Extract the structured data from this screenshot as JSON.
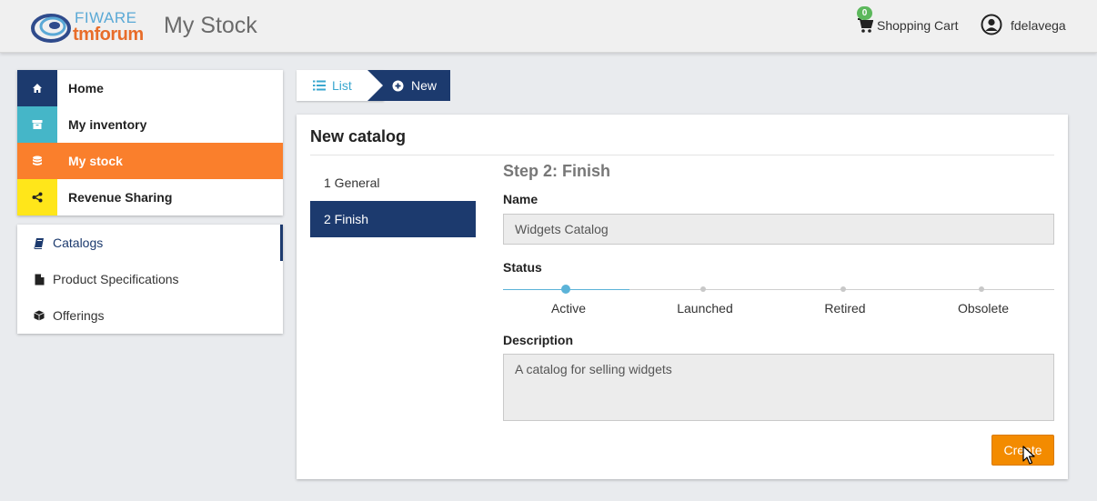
{
  "header": {
    "logo_text_top": "FIWARE",
    "logo_text_bottom": "tmforum",
    "title": "My Stock",
    "cart_count": "0",
    "cart_label": "Shopping Cart",
    "user_name": "fdelavega"
  },
  "sidebar": {
    "items": [
      {
        "label": "Home",
        "icon": "home-icon",
        "color": "#1c3a6e"
      },
      {
        "label": "My inventory",
        "icon": "archive-icon",
        "color": "#45b6c8"
      },
      {
        "label": "My stock",
        "icon": "database-icon",
        "color": "#fa7f2c"
      },
      {
        "label": "Revenue Sharing",
        "icon": "share-icon",
        "color": "#ffe61a"
      }
    ],
    "sub_items": [
      {
        "label": "Catalogs",
        "icon": "book-icon"
      },
      {
        "label": "Product Specifications",
        "icon": "file-icon"
      },
      {
        "label": "Offerings",
        "icon": "cube-icon"
      }
    ]
  },
  "breadcrumb": {
    "list_label": "List",
    "new_label": "New"
  },
  "panel": {
    "title": "New catalog",
    "steps": [
      {
        "label": "1 General"
      },
      {
        "label": "2 Finish"
      }
    ],
    "step_title": "Step 2: Finish",
    "name_label": "Name",
    "name_value": "Widgets Catalog",
    "status_label": "Status",
    "status_options": [
      "Active",
      "Launched",
      "Retired",
      "Obsolete"
    ],
    "status_selected": "Active",
    "description_label": "Description",
    "description_value": "A catalog for selling widgets",
    "create_button": "Create"
  },
  "colors": {
    "primary_navy": "#1c3a6e",
    "accent_orange": "#fa7f2c",
    "button_orange": "#f38b00",
    "link_blue": "#3aa7cf"
  }
}
